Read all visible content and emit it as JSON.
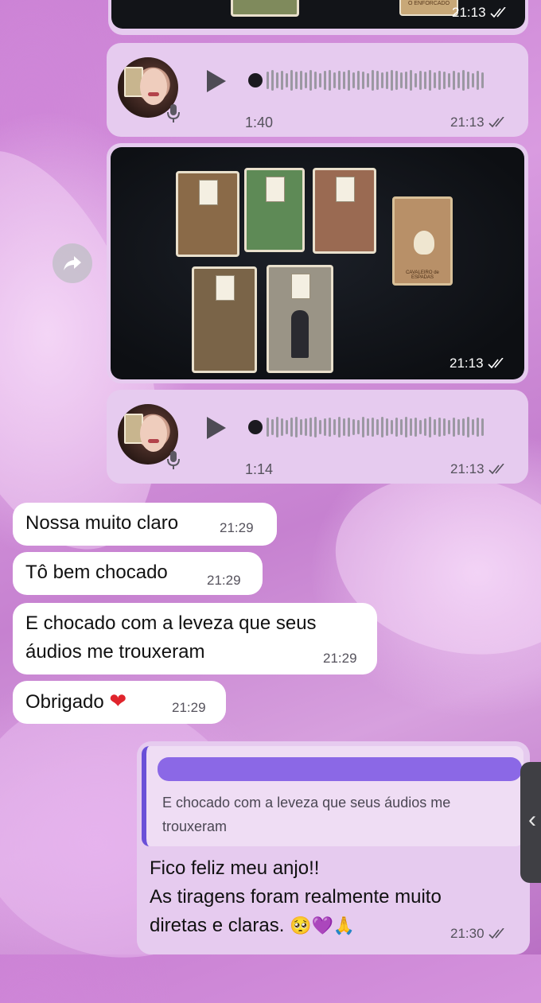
{
  "messages": {
    "top_media": {
      "time": "21:13",
      "label_peek": "O ENFORCADO"
    },
    "voice1": {
      "duration": "1:40",
      "time": "21:13"
    },
    "photo": {
      "time": "21:13",
      "card_label": "CAVALEIRO de ESPADAS"
    },
    "voice2": {
      "duration": "1:14",
      "time": "21:13"
    },
    "incoming": [
      {
        "text": "Nossa muito claro",
        "time": "21:29"
      },
      {
        "text": "Tô bem chocado",
        "time": "21:29"
      },
      {
        "text_line1": "E chocado com a leveza que seus",
        "text_line2": "áudios me trouxeram",
        "time": "21:29"
      },
      {
        "text": "Obrigado",
        "emoji": "❤",
        "time": "21:29"
      }
    ],
    "reply": {
      "quoted_line1": "E chocado com a leveza que seus áudios me",
      "quoted_line2": "trouxeram",
      "line1": "Fico feliz meu anjo!!",
      "line2": "As tiragens foram realmente muito",
      "line3": "diretas e claras.",
      "emojis": [
        "🥺",
        "💜",
        "🙏"
      ],
      "time": "21:30"
    }
  },
  "icons": {
    "forward": "forward-arrow-icon",
    "play": "play-icon",
    "mic": "microphone-icon",
    "read": "double-check-icon"
  },
  "colors": {
    "outgoing_bubble": "#e6cbef",
    "incoming_bubble": "#ffffff",
    "quote_bar": "#6a4fd8"
  }
}
